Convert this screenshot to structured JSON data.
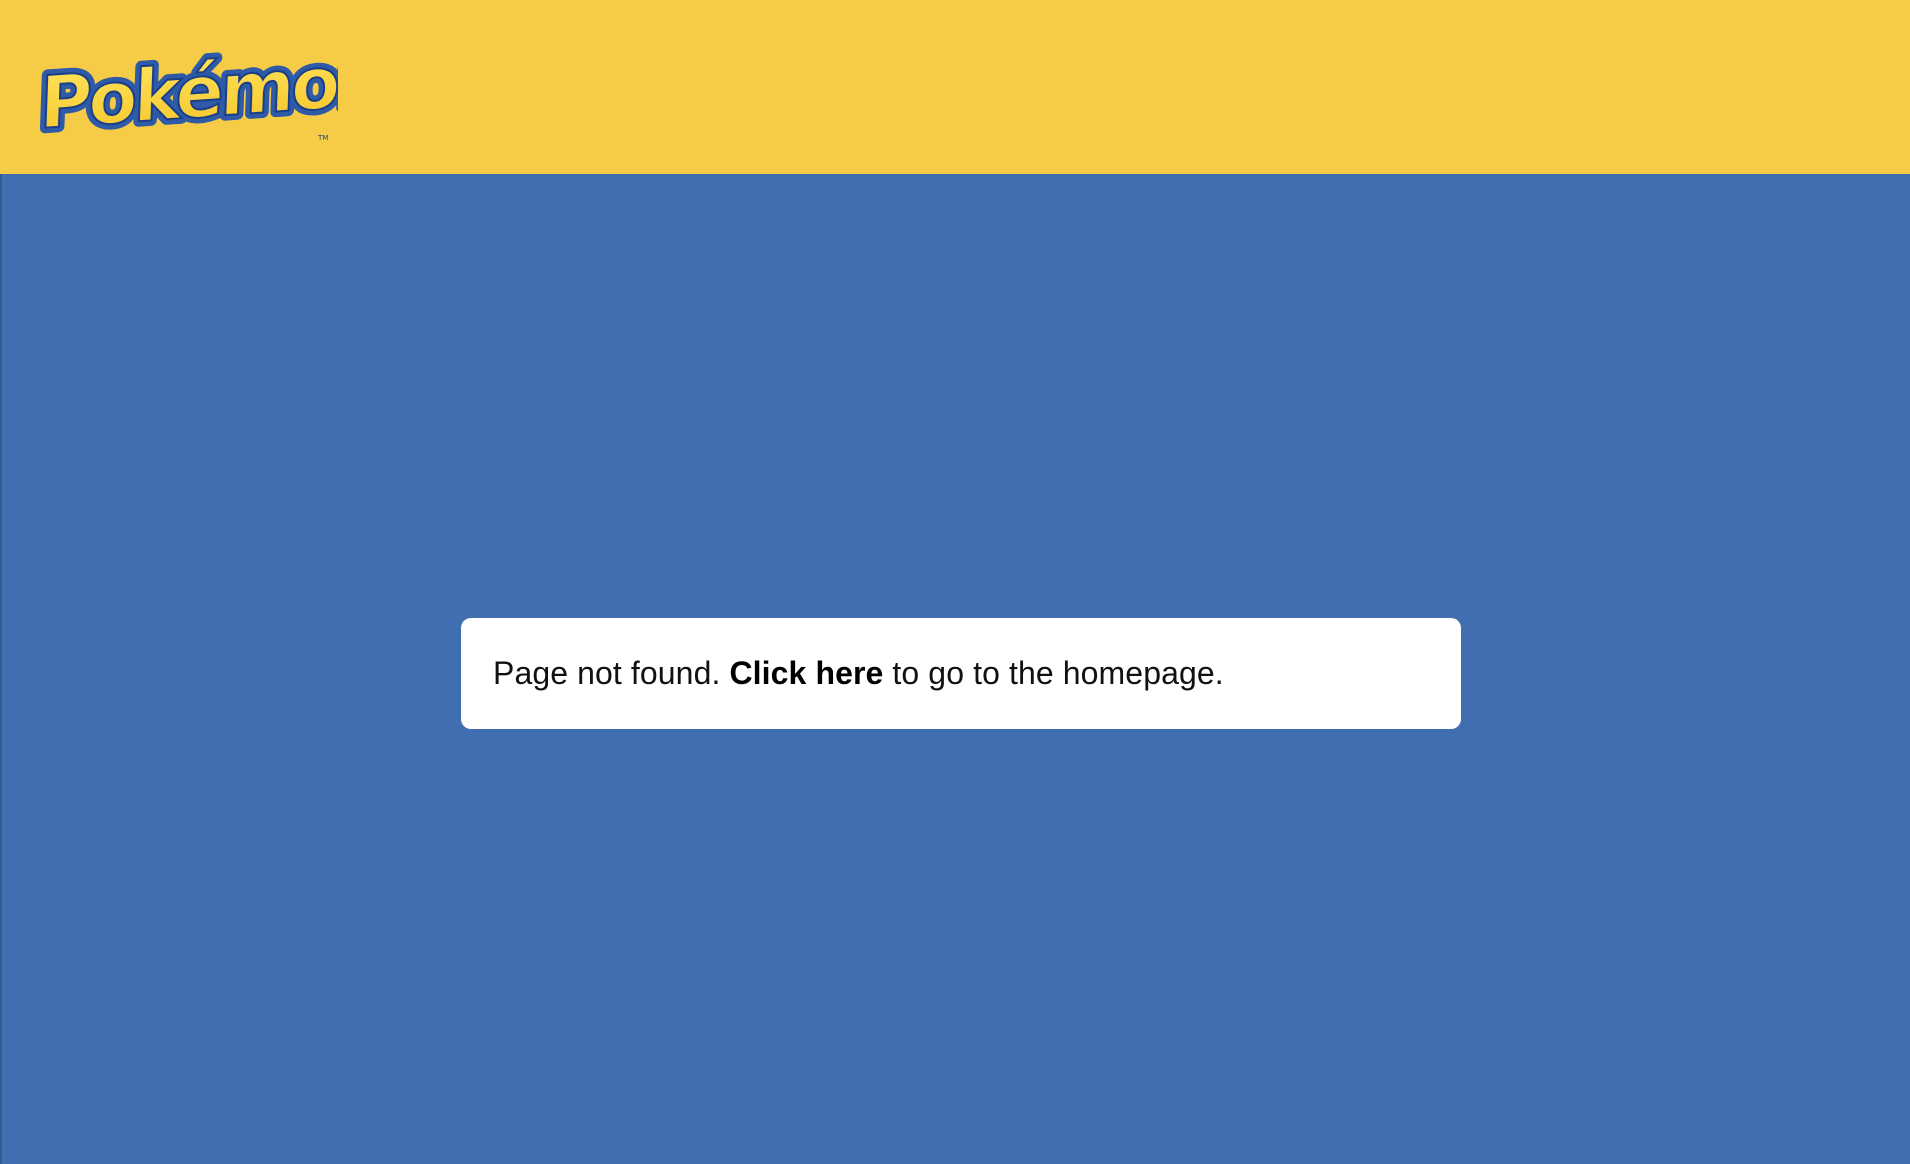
{
  "header": {
    "logo_text": "Pokémon",
    "logo_tm": "TM"
  },
  "message": {
    "prefix": "Page not found. ",
    "link_label": "Click here",
    "suffix": " to go to the homepage."
  },
  "colors": {
    "header_bg": "#f6cc46",
    "page_bg": "#416eb1",
    "card_bg": "#ffffff",
    "logo_fill": "#f8d63f",
    "logo_outline": "#2e5aa8"
  }
}
